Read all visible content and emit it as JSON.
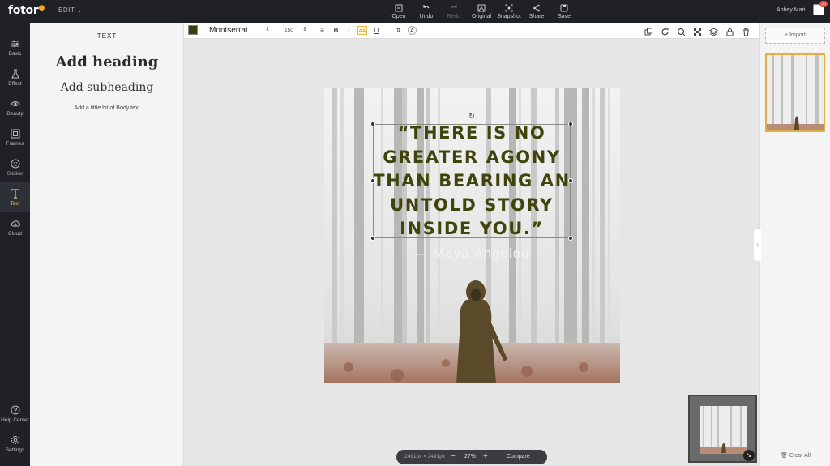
{
  "app": {
    "logo": "fotor",
    "edit_menu": "EDIT"
  },
  "top_tools": [
    {
      "label": "Open",
      "icon": "open-icon",
      "enabled": true
    },
    {
      "label": "Undo",
      "icon": "undo-icon",
      "enabled": true
    },
    {
      "label": "Redo",
      "icon": "redo-icon",
      "enabled": false
    },
    {
      "label": "Original",
      "icon": "original-icon",
      "enabled": true
    },
    {
      "label": "Snapshot",
      "icon": "snapshot-icon",
      "enabled": true
    },
    {
      "label": "Share",
      "icon": "share-icon",
      "enabled": true
    },
    {
      "label": "Save",
      "icon": "save-icon",
      "enabled": true
    }
  ],
  "user": {
    "name": "Abbey Mari...",
    "notifications": "20"
  },
  "sidebar": {
    "items": [
      {
        "label": "Basic",
        "icon": "sliders-icon"
      },
      {
        "label": "Effect",
        "icon": "flask-icon"
      },
      {
        "label": "Beauty",
        "icon": "eye-icon"
      },
      {
        "label": "Frames",
        "icon": "frame-icon"
      },
      {
        "label": "Sticker",
        "icon": "sticker-icon"
      },
      {
        "label": "Text",
        "icon": "text-icon",
        "active": true
      },
      {
        "label": "Cloud",
        "icon": "cloud-icon"
      }
    ],
    "bottom": [
      {
        "label": "Help Center",
        "icon": "help-icon"
      },
      {
        "label": "Settings",
        "icon": "settings-icon"
      }
    ]
  },
  "text_panel": {
    "title": "TEXT",
    "heading": "Add heading",
    "subheading": "Add subheading",
    "body": "Add a little bit of Body text"
  },
  "toolbar": {
    "color": "#3b3f10",
    "font": "Montserrat",
    "size": "150",
    "align_icon": "align-center-icon",
    "bold": "B",
    "italic": "I",
    "case": "AA",
    "underline": "U",
    "right_icons": [
      "duplicate-icon",
      "rotate-icon",
      "shape-icon",
      "transparency-icon",
      "layers-icon",
      "lock-icon",
      "trash-icon"
    ]
  },
  "canvas": {
    "quote_lines": [
      "“THERE IS NO",
      "GREATER AGONY",
      "THAN BEARING AN",
      "UNTOLD STORY",
      "INSIDE YOU.”"
    ],
    "attribution": "— Maya Angelou",
    "quote_color": "#3e440a"
  },
  "right_panel": {
    "import": "Import",
    "clear_all": "Clear All"
  },
  "zoom": {
    "dimensions": "2491px × 2491px",
    "minus": "−",
    "value": "27%",
    "plus": "+",
    "compare": "Compare"
  }
}
